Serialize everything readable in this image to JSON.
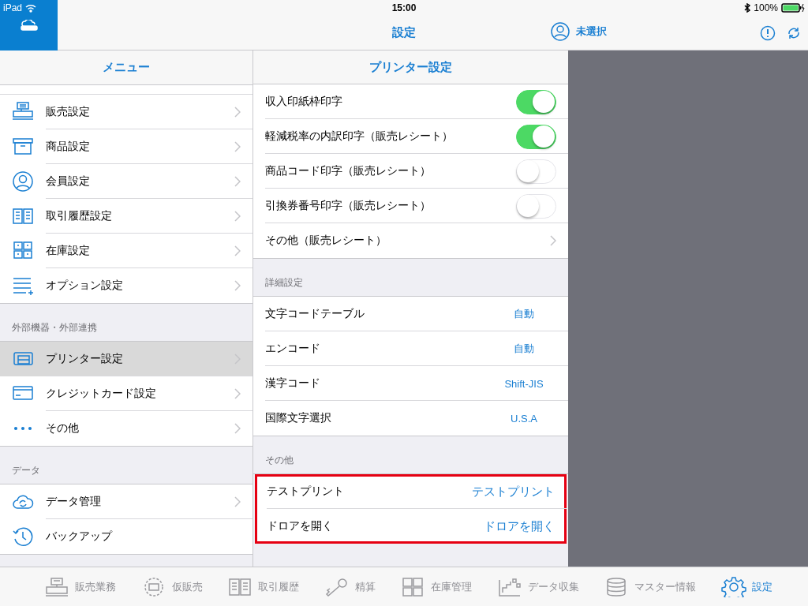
{
  "status_bar": {
    "device": "iPad",
    "time": "15:00",
    "battery": "100%"
  },
  "nav_bar": {
    "title": "設定",
    "user": "未選択"
  },
  "menu": {
    "title": "メニュー",
    "sections": [
      {
        "items": [
          {
            "label": "販売設定",
            "selected": false,
            "chevron": true
          },
          {
            "label": "商品設定",
            "selected": false,
            "chevron": true
          },
          {
            "label": "会員設定",
            "selected": false,
            "chevron": true
          },
          {
            "label": "取引履歴設定",
            "selected": false,
            "chevron": true
          },
          {
            "label": "在庫設定",
            "selected": false,
            "chevron": true
          },
          {
            "label": "オプション設定",
            "selected": false,
            "chevron": true
          }
        ]
      },
      {
        "header": "外部機器・外部連携",
        "items": [
          {
            "label": "プリンター設定",
            "selected": true,
            "chevron": true
          },
          {
            "label": "クレジットカード設定",
            "selected": false,
            "chevron": true
          },
          {
            "label": "その他",
            "selected": false,
            "chevron": true
          }
        ]
      },
      {
        "header": "データ",
        "items": [
          {
            "label": "データ管理",
            "selected": false,
            "chevron": true
          },
          {
            "label": "バックアップ",
            "selected": false,
            "chevron": false
          }
        ]
      }
    ]
  },
  "detail": {
    "title": "プリンター設定",
    "sections": [
      {
        "highlighted": false,
        "rows": [
          {
            "kind": "toggle",
            "label": "収入印紙枠印字",
            "on": true
          },
          {
            "kind": "toggle",
            "label": "軽減税率の内訳印字（販売レシート）",
            "on": true
          },
          {
            "kind": "toggle",
            "label": "商品コード印字（販売レシート）",
            "on": false
          },
          {
            "kind": "toggle",
            "label": "引換券番号印字（販売レシート）",
            "on": false
          },
          {
            "kind": "link",
            "label": "その他（販売レシート）"
          }
        ]
      },
      {
        "header": "詳細設定",
        "highlighted": false,
        "rows": [
          {
            "kind": "value",
            "label": "文字コードテーブル",
            "value": "自動"
          },
          {
            "kind": "value",
            "label": "エンコード",
            "value": "自動"
          },
          {
            "kind": "value",
            "label": "漢字コード",
            "value": "Shift-JIS"
          },
          {
            "kind": "value",
            "label": "国際文字選択",
            "value": "U.S.A"
          }
        ]
      },
      {
        "header": "その他",
        "highlighted": true,
        "rows": [
          {
            "kind": "action",
            "label": "テストプリント",
            "action": "テストプリント"
          },
          {
            "kind": "action",
            "label": "ドロアを開く",
            "action": "ドロアを開く"
          }
        ]
      }
    ]
  },
  "tab_bar": [
    {
      "label": "販売業務",
      "selected": false
    },
    {
      "label": "仮販売",
      "selected": false
    },
    {
      "label": "取引履歴",
      "selected": false
    },
    {
      "label": "精算",
      "selected": false
    },
    {
      "label": "在庫管理",
      "selected": false
    },
    {
      "label": "データ収集",
      "selected": false
    },
    {
      "label": "マスター情報",
      "selected": false
    },
    {
      "label": "設定",
      "selected": true
    }
  ]
}
